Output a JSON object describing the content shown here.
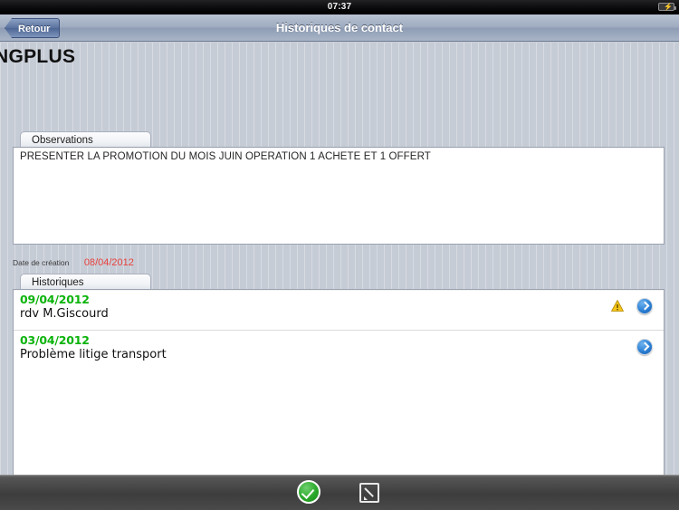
{
  "status_bar": {
    "time": "07:37",
    "battery_icon": "battery-charging-icon"
  },
  "navbar": {
    "back_label": "Retour",
    "title": "Historiques de contact"
  },
  "page": {
    "title": "NGPLUS"
  },
  "observations": {
    "tab_label": "Observations",
    "text": "PRESENTER LA PROMOTION DU MOIS JUIN OPERATION 1 ACHETE ET 1 OFFERT"
  },
  "creation": {
    "label": "Date de création",
    "value": "08/04/2012",
    "value_color": "#e8413c"
  },
  "historiques": {
    "tab_label": "Historiques",
    "date_color": "#0bb30b",
    "rows": [
      {
        "date": "09/04/2012",
        "text": "rdv M.Giscourd",
        "warning": true,
        "disclosure": true
      },
      {
        "date": "03/04/2012",
        "text": "Problème litige transport",
        "warning": false,
        "disclosure": true
      }
    ]
  },
  "toolbar": {
    "validate_icon": "check-circle-icon",
    "edit_icon": "compose-edit-icon"
  }
}
